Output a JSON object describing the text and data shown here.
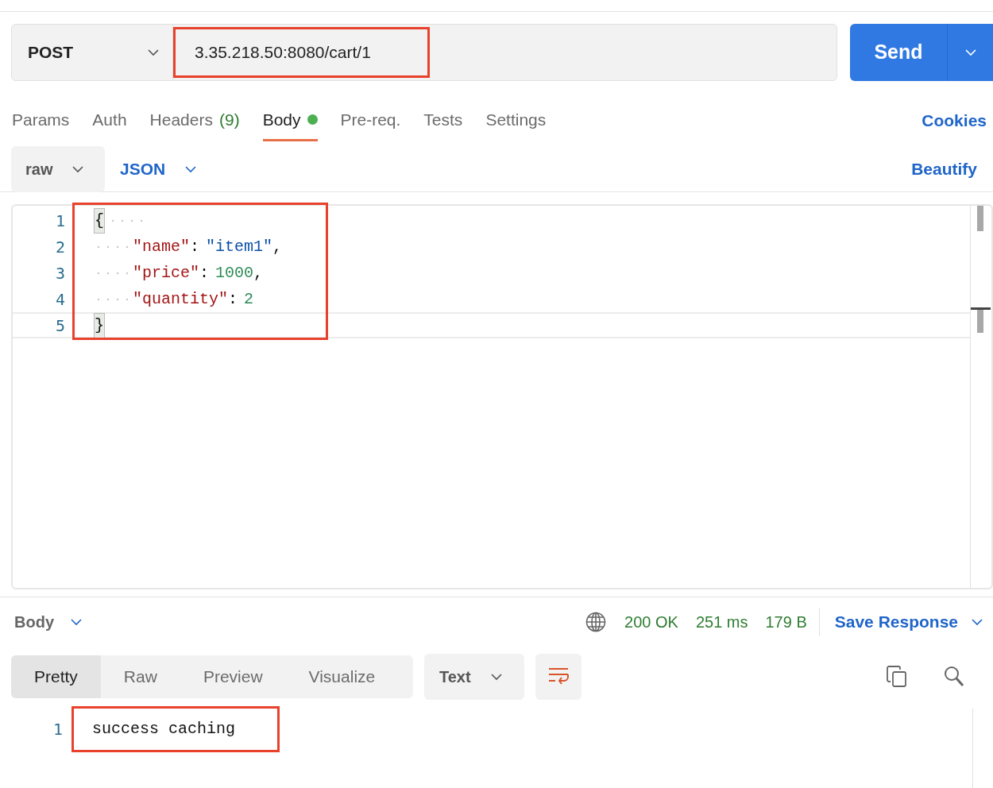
{
  "request": {
    "method": "POST",
    "url": "3.35.218.50:8080/cart/1",
    "send": "Send"
  },
  "tabs": [
    {
      "label": "Params",
      "selected": false,
      "dot": false
    },
    {
      "label": "Auth",
      "selected": false,
      "dot": false
    },
    {
      "label": "Headers",
      "count": "(9)",
      "selected": false,
      "dot": false
    },
    {
      "label": "Body",
      "selected": true,
      "dot": true
    },
    {
      "label": "Pre-req.",
      "selected": false,
      "dot": false
    },
    {
      "label": "Tests",
      "selected": false,
      "dot": false
    },
    {
      "label": "Settings",
      "selected": false,
      "dot": false
    }
  ],
  "cookies": "Cookies",
  "body_options": {
    "mode": "raw",
    "language": "JSON",
    "beautify": "Beautify"
  },
  "editor": {
    "lines": [
      {
        "number": "1",
        "active": false,
        "tokens": [
          {
            "kind": "brace",
            "text": "{"
          }
        ]
      },
      {
        "number": "2",
        "active": false,
        "tokens": [
          {
            "kind": "key",
            "text": "\"name\""
          },
          {
            "kind": "punct",
            "text": ":"
          },
          {
            "kind": "string",
            "text": "\"item1\""
          },
          {
            "kind": "punct",
            "text": ","
          }
        ]
      },
      {
        "number": "3",
        "active": false,
        "tokens": [
          {
            "kind": "key",
            "text": "\"price\""
          },
          {
            "kind": "punct",
            "text": ":"
          },
          {
            "kind": "number",
            "text": "1000"
          },
          {
            "kind": "punct",
            "text": ","
          }
        ]
      },
      {
        "number": "4",
        "active": false,
        "tokens": [
          {
            "kind": "key",
            "text": "\"quantity\""
          },
          {
            "kind": "punct",
            "text": ":"
          },
          {
            "kind": "number",
            "text": "2"
          }
        ]
      },
      {
        "number": "5",
        "active": true,
        "tokens": [
          {
            "kind": "brace",
            "text": "}"
          }
        ]
      }
    ]
  },
  "response": {
    "label": "Body",
    "status": "200 OK",
    "time": "251 ms",
    "size": "179 B",
    "save": "Save Response",
    "views": [
      {
        "label": "Pretty",
        "selected": true
      },
      {
        "label": "Raw",
        "selected": false
      },
      {
        "label": "Preview",
        "selected": false
      },
      {
        "label": "Visualize",
        "selected": false
      }
    ],
    "format": "Text",
    "wrap": true,
    "lines": [
      {
        "number": "1",
        "text": "success caching"
      }
    ]
  }
}
